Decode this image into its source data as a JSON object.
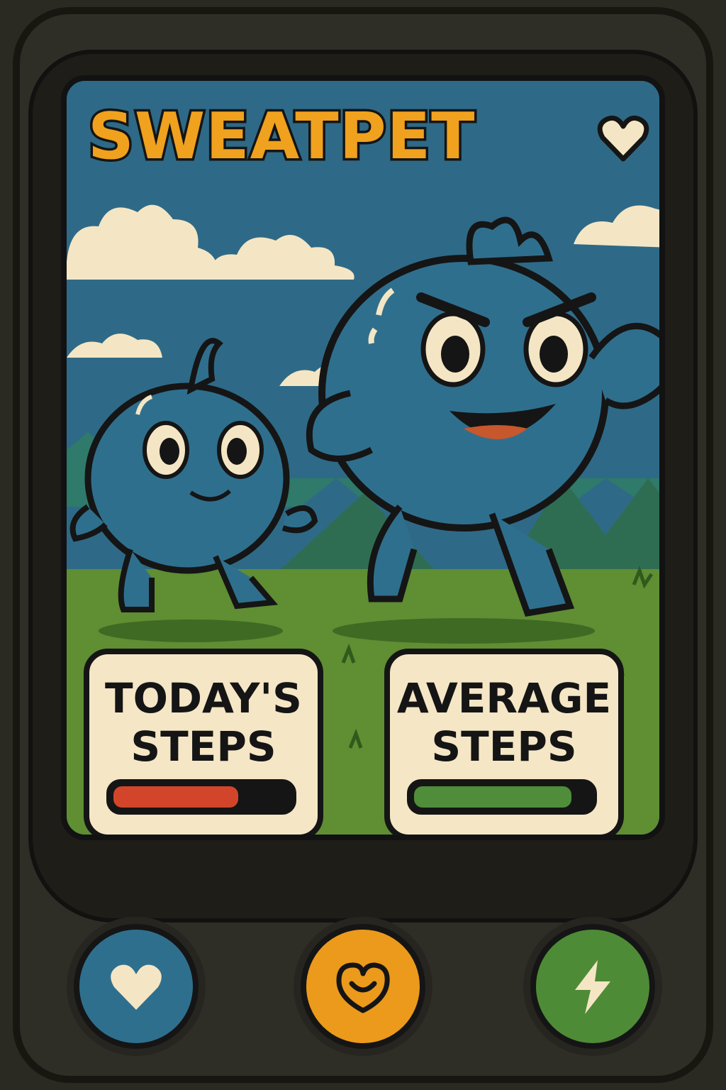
{
  "app": {
    "title": "SWEATPET",
    "accent_color": "#f0a11e",
    "title_icon": "heart-icon"
  },
  "stats": {
    "today": {
      "label": "TODAY'S\nSTEPS",
      "progress": 0.72,
      "color": "#d2452b"
    },
    "average": {
      "label": "AVERAGE\nSTEPS",
      "progress": 0.9,
      "color": "#4f8d3a"
    }
  },
  "buttons": [
    {
      "icon": "heart-icon",
      "color": "#2f6f8e"
    },
    {
      "icon": "smile-heart-icon",
      "color": "#eb9a1b"
    },
    {
      "icon": "lightning-icon",
      "color": "#4e8b37"
    }
  ]
}
